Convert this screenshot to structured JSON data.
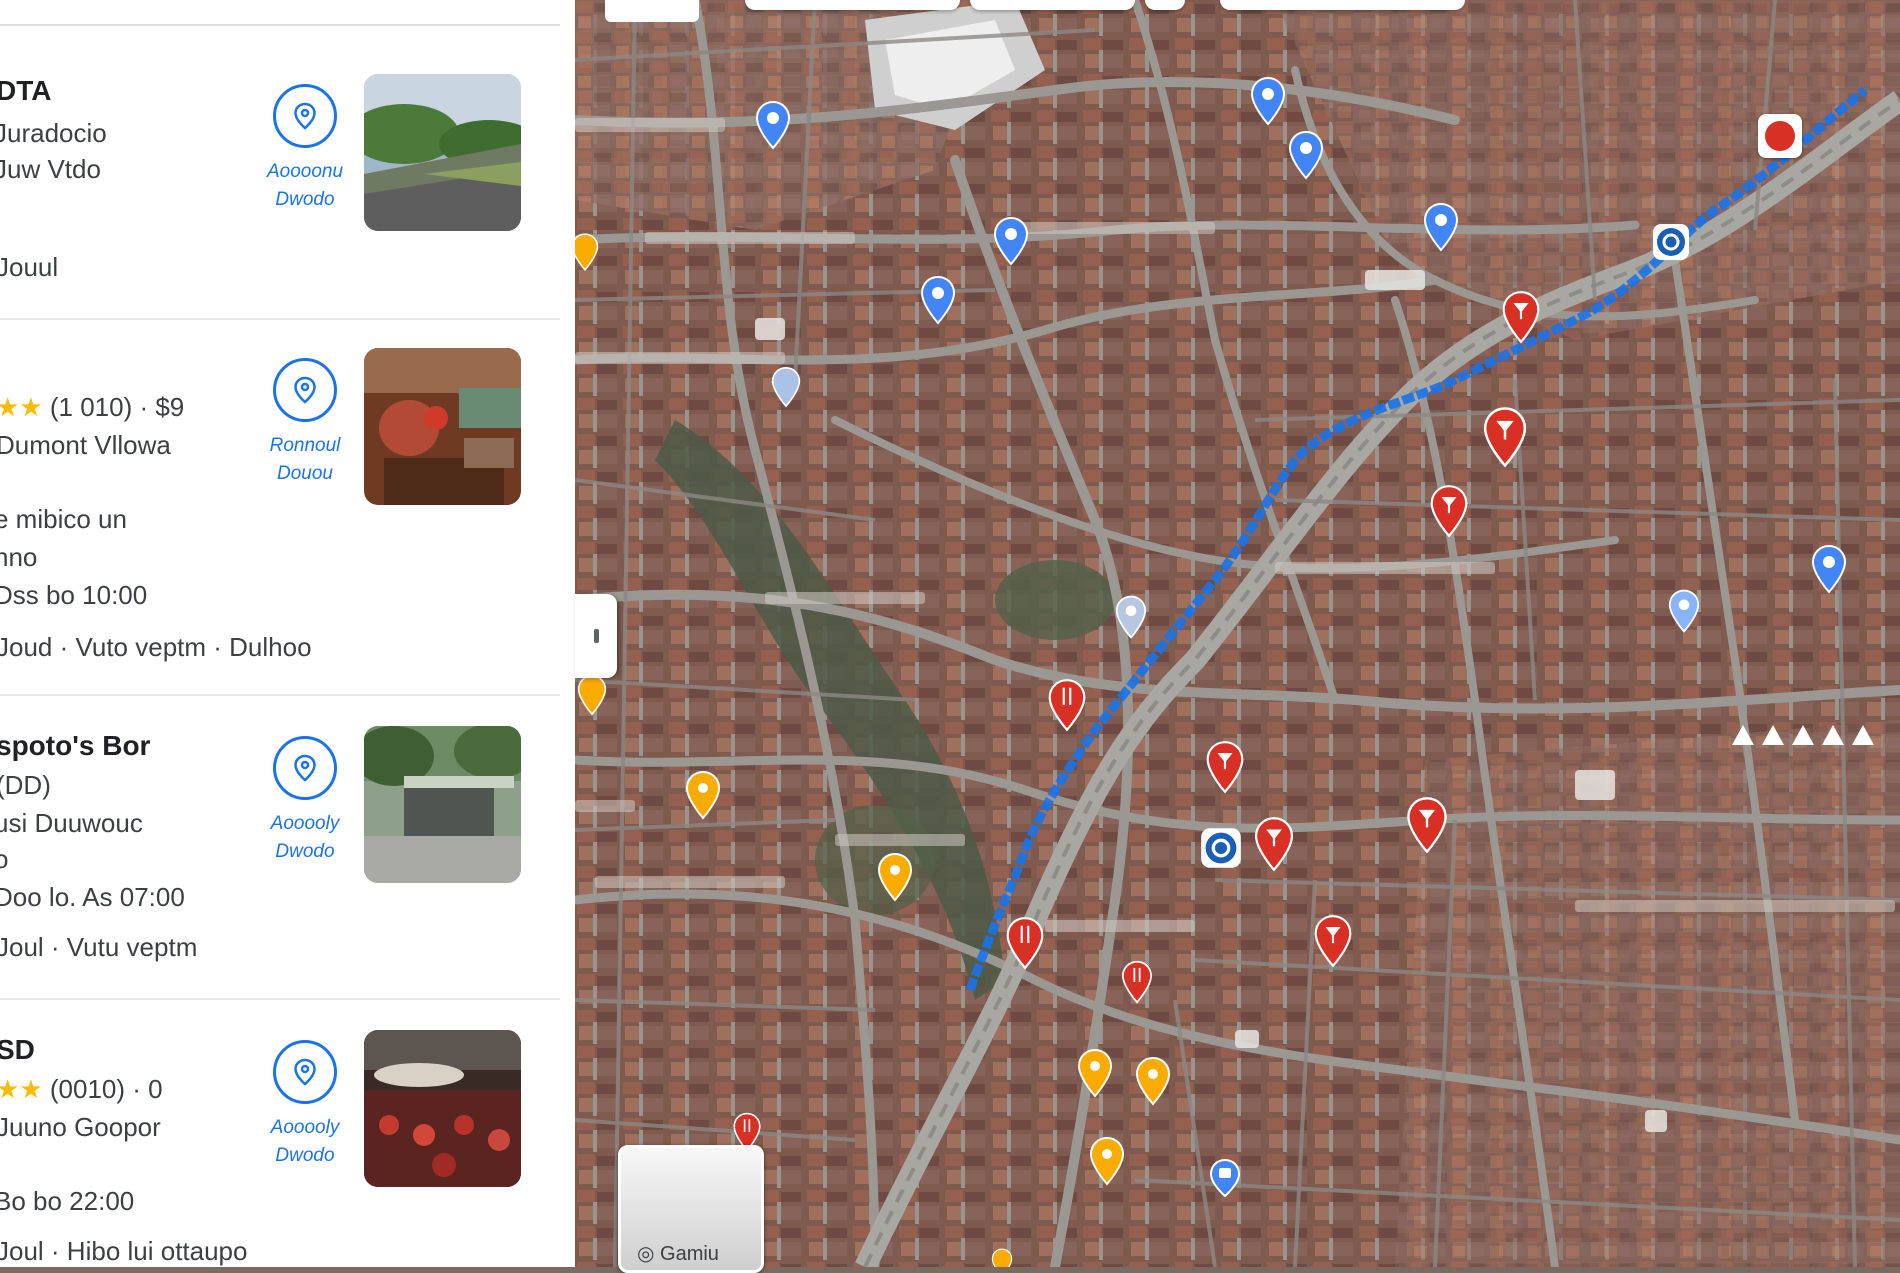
{
  "results": [
    {
      "name": "DTA",
      "lines": [
        "Juradocio",
        "Juw Vtdo",
        "",
        "Jouul"
      ],
      "action": [
        "Aoooonu",
        "Dwodo"
      ]
    },
    {
      "name": "",
      "rating_text": "(1 010) · $9",
      "lines": [
        "Dumont Vllowa",
        "",
        "e mibico un",
        "nno",
        "Dss bo 10:00",
        "Joud · Vuto veptm · Dulhoo"
      ],
      "action": [
        "Ronnoul",
        "Douou"
      ]
    },
    {
      "name": "spoto's Bor",
      "lines": [
        "(DD)",
        "usi Duuwouc",
        "o",
        "Doo lo. As 07:00",
        "Joul · Vutu veptm"
      ],
      "action": [
        "Aooooly",
        "Dwodo"
      ]
    },
    {
      "name": "SD",
      "rating_text": "(0010) · 0",
      "lines": [
        "Juuno Goopor",
        "",
        "Bo bo 22:00",
        "Joul · Hibo lui ottaupo"
      ],
      "action": [
        "Aooooly",
        "Dwodo"
      ]
    }
  ],
  "map": {
    "layers_label": "Gamiu",
    "colors": {
      "route": "#1a73e8",
      "pin_blue": "#4285f4",
      "pin_red": "#d93025",
      "pin_yellow": "#f9ab00",
      "pin_pale": "#8ab4f8",
      "water": "#4a6b4a"
    },
    "icons": [
      "info-pin-icon",
      "bar-pin-icon",
      "restaurant-pin-icon",
      "transit-stop-icon"
    ]
  }
}
